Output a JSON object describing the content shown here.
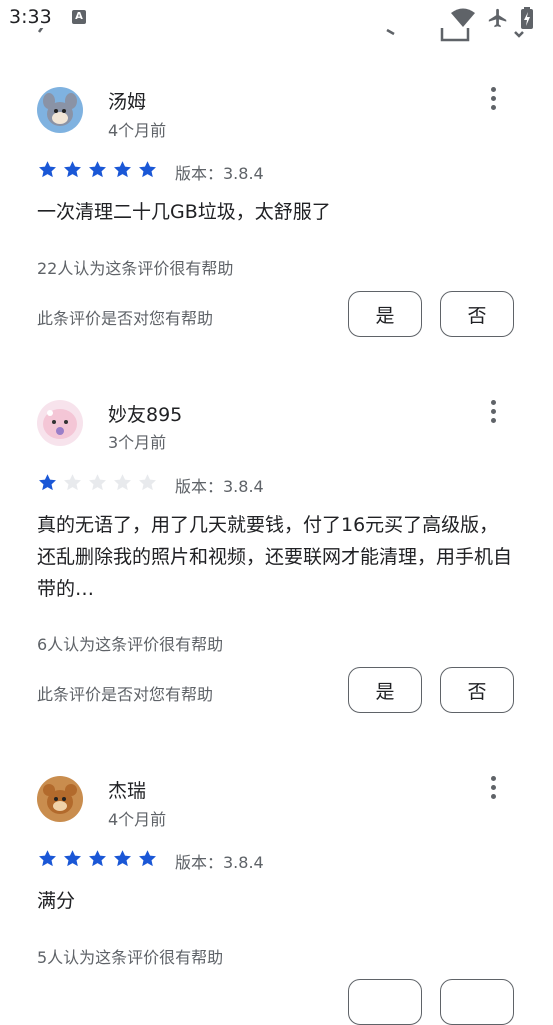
{
  "status_bar": {
    "time": "3:33",
    "notification_icon": "A"
  },
  "reviews": [
    {
      "user": "汤姆",
      "date": "4个月前",
      "rating": 5,
      "version": "版本：3.8.4",
      "text": "一次清理二十几GB垃圾，太舒服了",
      "helpful_count": "22人认为这条评价很有帮助",
      "helpful_question": "此条评价是否对您有帮助",
      "yes_label": "是",
      "no_label": "否"
    },
    {
      "user": "妙友895",
      "date": "3个月前",
      "rating": 1,
      "version": "版本：3.8.4",
      "text": "真的无语了，用了几天就要钱，付了16元买了高级版，还乱删除我的照片和视频，还要联网才能清理，用手机自带的…",
      "helpful_count": "6人认为这条评价很有帮助",
      "helpful_question": "此条评价是否对您有帮助",
      "yes_label": "是",
      "no_label": "否"
    },
    {
      "user": "杰瑞",
      "date": "4个月前",
      "rating": 5,
      "version": "版本：3.8.4",
      "text": "满分",
      "helpful_count": "5人认为这条评价很有帮助"
    }
  ],
  "colors": {
    "star_filled": "#1a57d6",
    "star_empty": "#e8eaed",
    "text_secondary": "#5f6368"
  }
}
